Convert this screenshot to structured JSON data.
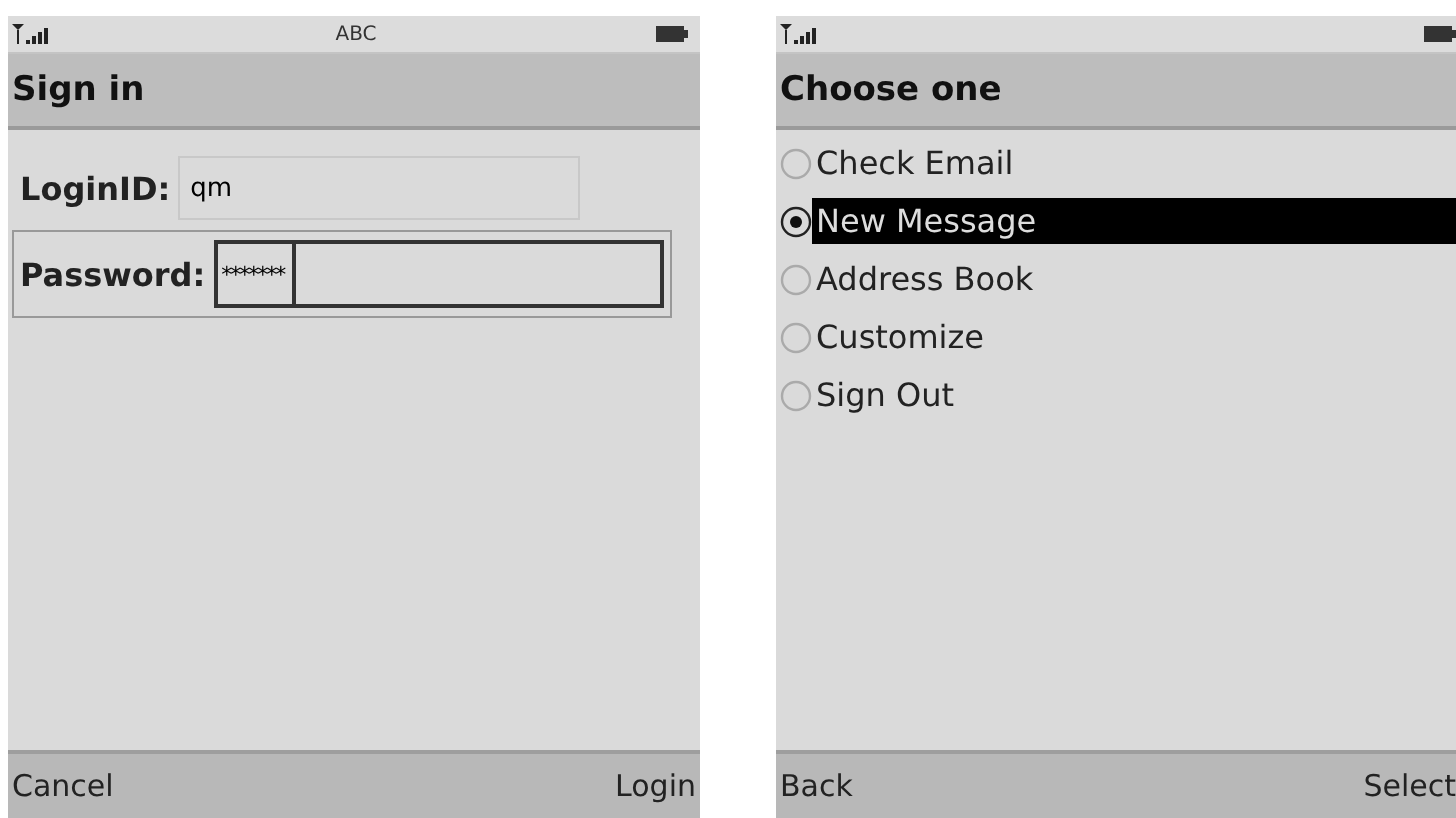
{
  "screens": [
    {
      "kind": "form",
      "status": {
        "mode": "ABC"
      },
      "title": "Sign in",
      "fields": [
        {
          "label": "LoginID:",
          "value": "qm",
          "focused": false
        },
        {
          "label": "Password:",
          "value": "*******",
          "focused": true
        }
      ],
      "softkeys": {
        "left": "Cancel",
        "right": "Login"
      }
    },
    {
      "kind": "menu",
      "title": "Choose one",
      "options": [
        {
          "label": "Check Email",
          "selected": false
        },
        {
          "label": "New Message",
          "selected": true
        },
        {
          "label": "Address Book",
          "selected": false
        },
        {
          "label": "Customize",
          "selected": false
        },
        {
          "label": "Sign Out",
          "selected": false
        }
      ],
      "softkeys": {
        "left": "Back",
        "right": "Select"
      }
    }
  ]
}
